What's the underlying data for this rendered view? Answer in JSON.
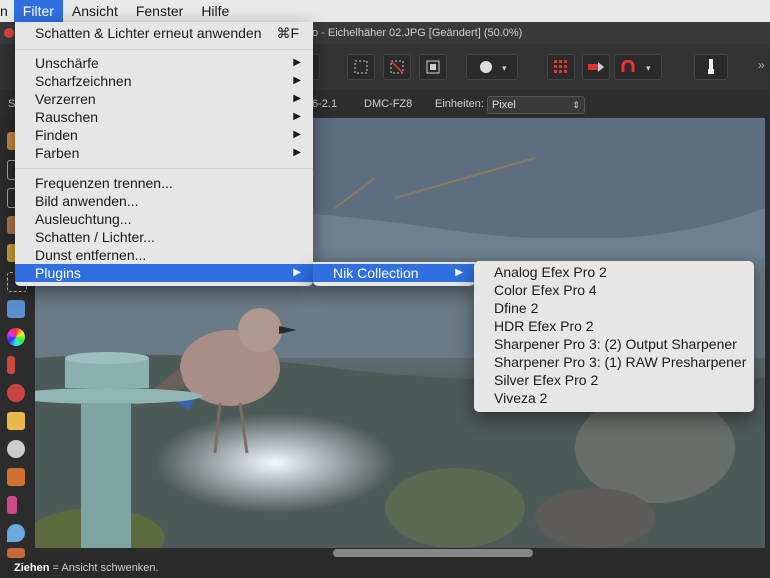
{
  "menubar": {
    "items": [
      "n",
      "Filter",
      "Ansicht",
      "Fenster",
      "Hilfe"
    ]
  },
  "titlebar": {
    "title": "o - Eichelhäher 02.JPG [Geändert] (50.0%)"
  },
  "contextbar": {
    "lens": "6-2.1",
    "camera": "DMC-FZ8",
    "units_label": "Einheiten:",
    "units_value": "Pixel"
  },
  "filter_menu": {
    "repeat": "Schatten & Lichter erneut anwenden",
    "repeat_shortcut": "⌘F",
    "group1": [
      "Unschärfe",
      "Scharfzeichnen",
      "Verzerren",
      "Rauschen",
      "Finden",
      "Farben"
    ],
    "group2": [
      "Frequenzen trennen...",
      "Bild anwenden...",
      "Ausleuchtung...",
      "Schatten / Lichter...",
      "Dunst entfernen..."
    ],
    "plugins": "Plugins"
  },
  "plugins_menu": {
    "nik": "Nik Collection"
  },
  "nik_menu": {
    "items": [
      "Analog Efex Pro 2",
      "Color Efex Pro 4",
      "Dfine 2",
      "HDR Efex Pro 2",
      "Sharpener Pro 3: (2) Output Sharpener",
      "Sharpener Pro 3: (1) RAW Presharpener",
      "Silver Efex Pro 2",
      "Viveza 2"
    ]
  },
  "statusbar": {
    "bold": "Ziehen",
    "text": " = Ansicht schwenken."
  },
  "colors": {
    "menu_highlight": "#2f6fe0"
  },
  "icons": [
    "close-icon",
    "marquee-icon",
    "crop-icon",
    "circle-icon",
    "grid-icon",
    "magnet-icon",
    "brush-icon",
    "eyedropper-icon"
  ]
}
